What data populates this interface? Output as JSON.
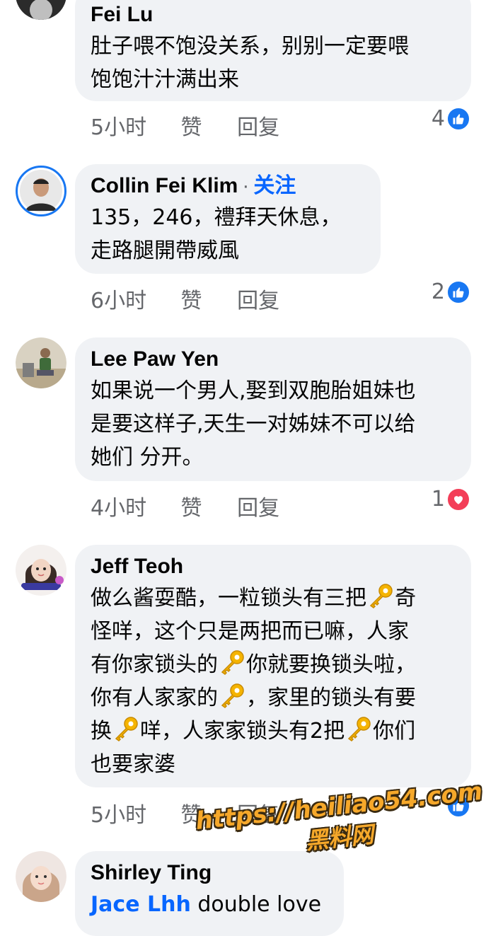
{
  "comments": [
    {
      "name": "Fei Lu",
      "lines": [
        "肚子喂不饱没关系，别别一定要喂",
        "饱饱汁汁满出来"
      ],
      "time": "5小时",
      "like": "赞",
      "reply": "回复",
      "reaction_count": "4",
      "reaction_icon": "like-icon"
    },
    {
      "name": "Collin Fei Klim",
      "separator": "·",
      "follow": "关注",
      "lines": [
        "135，246，禮拜天休息，",
        "走路腿開帶威風"
      ],
      "time": "6小时",
      "like": "赞",
      "reply": "回复",
      "reaction_count": "2",
      "reaction_icon": "like-icon"
    },
    {
      "name": "Lee Paw Yen",
      "lines": [
        "如果说一个男人,娶到双胞胎姐妹也",
        "是要这样子,天生一对姊妹不可以给",
        "她们 分开。"
      ],
      "time": "4小时",
      "like": "赞",
      "reply": "回复",
      "reaction_count": "1",
      "reaction_icon": "love-icon"
    },
    {
      "name": "Jeff Teoh",
      "segments": {
        "l1a": "做么酱耍酷，一粒锁头有三把",
        "l1b": "奇",
        "l2": "怪咩，这个只是两把而已嘛，人家",
        "l3a": "有你家锁头的",
        "l3b": "你就要换锁头啦，",
        "l4a": "你有人家家的",
        "l4b": "，家里的锁头有要",
        "l5a": "换",
        "l5b": "咩，人家家锁头有2把",
        "l5c": "你们",
        "l6": "也要家婆"
      },
      "time": "5小时",
      "like": "赞",
      "reply": "回复",
      "reaction_icon": "like-icon"
    },
    {
      "name": "Shirley Ting",
      "mention": "Jace Lhh",
      "text": "double love"
    }
  ],
  "watermark": {
    "url": "https://heiliao54.com",
    "label": "黑料网"
  },
  "colors": {
    "bubble": "#f0f2f5",
    "meta": "#65676b",
    "link": "#0866ff",
    "like": "#1877f2",
    "love": "#f33e58"
  }
}
